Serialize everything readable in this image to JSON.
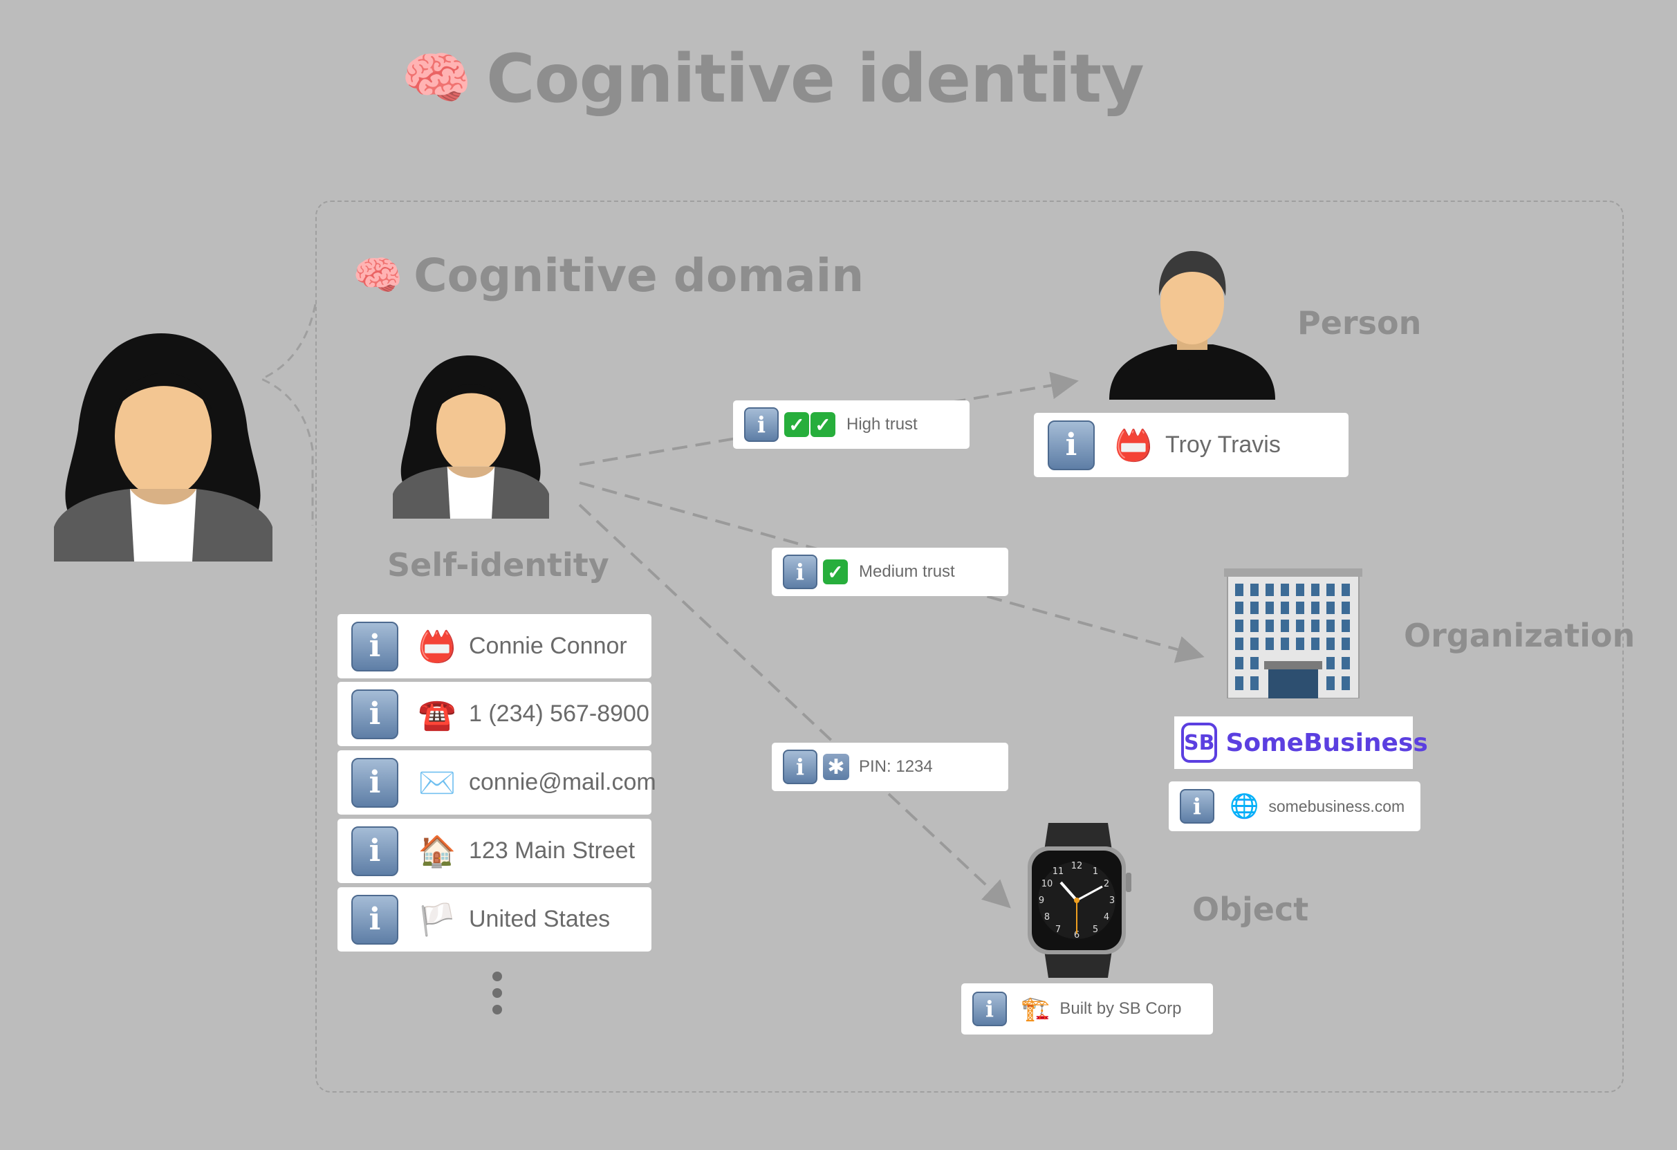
{
  "title": {
    "icon": "brain-icon",
    "text": "Cognitive identity"
  },
  "domain": {
    "icon": "brain-icon",
    "text": "Cognitive domain"
  },
  "labels": {
    "self_identity": "Self-identity",
    "person": "Person",
    "organization": "Organization",
    "object": "Object"
  },
  "self_attributes": [
    {
      "icon": "name-badge-icon",
      "glyph": "📛",
      "text": "Connie Connor"
    },
    {
      "icon": "telephone-icon",
      "glyph": "☎️",
      "text": "1 (234) 567-8900"
    },
    {
      "icon": "envelope-icon",
      "glyph": "✉️",
      "text": "connie@mail.com"
    },
    {
      "icon": "house-icon",
      "glyph": "🏠",
      "text": "123 Main Street"
    },
    {
      "icon": "white-flag-icon",
      "glyph": "🏳️",
      "text": "United States"
    }
  ],
  "relations": {
    "high": {
      "checks": 2,
      "text": "High trust"
    },
    "medium": {
      "checks": 1,
      "text": "Medium trust"
    },
    "pin": {
      "glyph": "✱",
      "text": "PIN: 1234"
    }
  },
  "person_card": {
    "icon": "name-badge-icon",
    "glyph": "📛",
    "text": "Troy Travis"
  },
  "organization": {
    "logo_mark": "SB",
    "logo_name": "SomeBusiness",
    "brand_color": "#5b3fe0",
    "website": {
      "icon": "globe-icon",
      "glyph": "🌐",
      "text": "somebusiness.com"
    }
  },
  "object_card": {
    "icon": "crane-icon",
    "glyph": "🏗️",
    "text": "Built by SB Corp"
  },
  "colors": {
    "background": "#bcbcbc",
    "heading": "#8e8e8e",
    "info_icon": "#6f8db3"
  }
}
